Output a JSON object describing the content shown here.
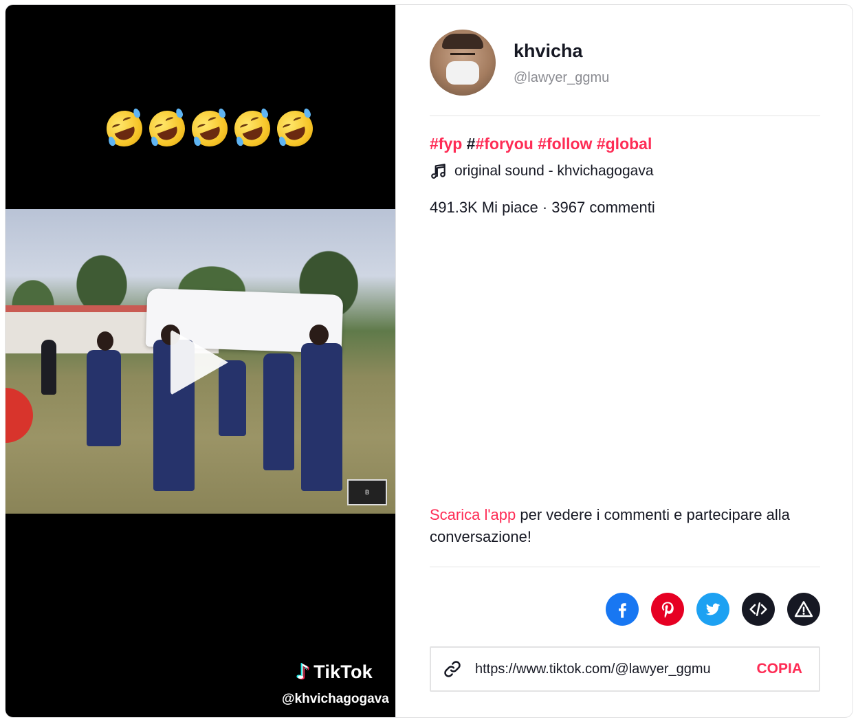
{
  "video": {
    "brand": "TikTok",
    "watermark_handle": "@khvichagogava",
    "overlay_emoji_count": 5,
    "overlay_emoji": "rolling-on-the-floor-laughing"
  },
  "author": {
    "name": "khvicha",
    "handle": "@lawyer_ggmu"
  },
  "caption": {
    "tags": [
      {
        "prefix": "",
        "text": "#fyp"
      },
      {
        "prefix": " #",
        "text": "#foryou"
      },
      {
        "prefix": " ",
        "text": "#follow"
      },
      {
        "prefix": " ",
        "text": "#global"
      }
    ]
  },
  "sound": {
    "label": "original sound - khvichagogava"
  },
  "stats": {
    "text": "491.3K Mi piace · 3967 commenti"
  },
  "cta": {
    "link": "Scarica l'app",
    "rest": " per vedere i commenti e partecipare alla conversazione!"
  },
  "share": {
    "icons": [
      "facebook-icon",
      "pinterest-icon",
      "twitter-icon",
      "embed-icon",
      "report-icon"
    ]
  },
  "url_box": {
    "url": "https://www.tiktok.com/@lawyer_ggmu",
    "copy_label": "COPIA"
  },
  "colors": {
    "accent": "#fe2c55",
    "facebook": "#1877f2",
    "pinterest": "#e60023",
    "twitter": "#1da1f2",
    "dark": "#161823"
  }
}
